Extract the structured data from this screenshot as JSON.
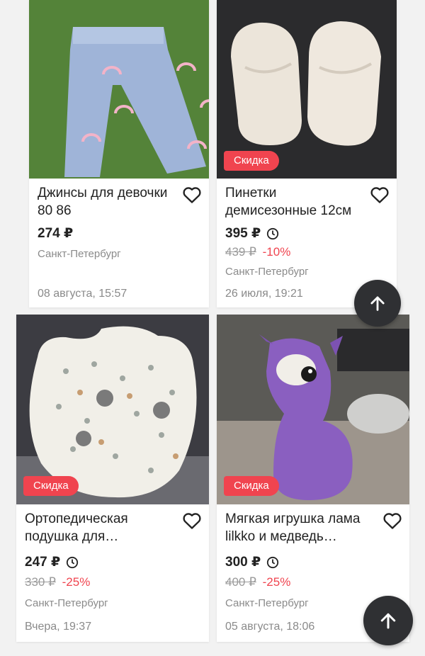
{
  "cards": [
    {
      "title": "Джинсы для девочки 80 86",
      "price": "274 ₽",
      "city": "Санкт-Петербург",
      "date": "08 августа, 15:57"
    },
    {
      "title": "Пинетки демисезонные 12см",
      "badge": "Скидка",
      "price": "395 ₽",
      "old_price": "439 ₽",
      "discount": "-10%",
      "city": "Санкт-Петербург",
      "date": "26 июля, 19:21"
    },
    {
      "title": "Ортопедическая подушка для…",
      "badge": "Скидка",
      "price": "247 ₽",
      "old_price": "330 ₽",
      "discount": "-25%",
      "city": "Санкт-Петербург",
      "date": "Вчера, 19:37"
    },
    {
      "title": "Мягкая игрушка лама lilkko и медведь…",
      "badge": "Скидка",
      "price": "300 ₽",
      "old_price": "400 ₽",
      "discount": "-25%",
      "city": "Санкт-Петербург",
      "date": "05 августа, 18:06"
    }
  ],
  "icons": {
    "favorite": "heart-icon",
    "timer": "clock-icon",
    "scroll_top": "arrow-up-icon"
  },
  "colors": {
    "discount_red": "#f0444f",
    "fab_dark": "#2f3033"
  }
}
